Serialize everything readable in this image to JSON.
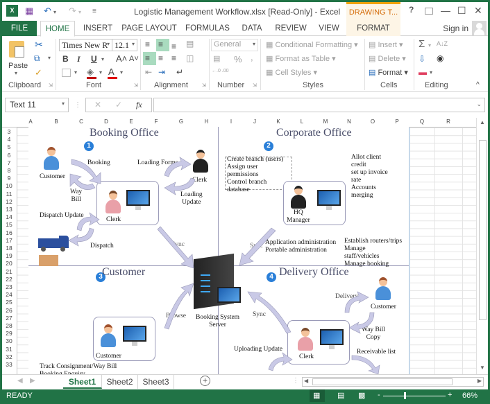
{
  "window": {
    "title": "Logistic Management Workflow.xlsx  [Read-Only] - Excel",
    "contextual_tab_group": "DRAWING T...",
    "help": "?",
    "restore_ribbon": "↑",
    "minimize": "—",
    "maximize": "☐",
    "close": "✕"
  },
  "quick_access": {
    "save": "💾",
    "undo": "↶",
    "redo": "↷",
    "customize": "≡"
  },
  "tabs": [
    "FILE",
    "HOME",
    "INSERT",
    "PAGE LAYOUT",
    "FORMULAS",
    "DATA",
    "REVIEW",
    "VIEW",
    "FORMAT"
  ],
  "sign_in": "Sign in",
  "ribbon": {
    "clipboard": {
      "label": "Clipboard",
      "paste": "Paste"
    },
    "font": {
      "label": "Font",
      "font_name": "Times New R",
      "font_size": "12.1",
      "bold": "B",
      "italic": "I",
      "underline": "U",
      "grow": "A˄",
      "shrink": "A˅",
      "font_color": "A"
    },
    "alignment": {
      "label": "Alignment"
    },
    "number": {
      "label": "Number",
      "format": "General",
      "percent": "%",
      "comma": ",",
      "inc_decimal": "←.0 .00",
      "dec_decimal": ".00 →.0"
    },
    "styles": {
      "label": "Styles",
      "conditional": "Conditional Formatting",
      "format_table": "Format as Table",
      "cell_styles": "Cell Styles"
    },
    "cells": {
      "label": "Cells",
      "insert": "Insert",
      "delete": "Delete",
      "format": "Format"
    },
    "editing": {
      "label": "Editing",
      "sum": "Σ",
      "sort": "A↓Z",
      "find": "🔍"
    },
    "collapse": "^"
  },
  "formula_bar": {
    "name_box": "Text 11",
    "cancel": "✕",
    "enter": "✓",
    "fx": "fx",
    "value": ""
  },
  "columns": [
    "A",
    "B",
    "C",
    "D",
    "E",
    "F",
    "G",
    "H",
    "I",
    "J",
    "K",
    "L",
    "M",
    "N",
    "O",
    "P",
    "Q",
    "R"
  ],
  "rows": [
    "3",
    "4",
    "5",
    "6",
    "7",
    "8",
    "9",
    "10",
    "11",
    "12",
    "13",
    "14",
    "15",
    "16",
    "17",
    "18",
    "19",
    "20",
    "21",
    "22",
    "23",
    "24",
    "25",
    "26",
    "27",
    "28",
    "29",
    "30",
    "31",
    "32",
    "33"
  ],
  "diagram": {
    "quadrants": {
      "booking": {
        "title": "Booking Office",
        "badge": "1"
      },
      "corporate": {
        "title": "Corporate Office",
        "badge": "2"
      },
      "customer": {
        "title": "Customer",
        "badge": "3"
      },
      "delivery": {
        "title": "Delivery Office",
        "badge": "4"
      }
    },
    "booking_labels": {
      "customer": "Customer",
      "booking": "Booking",
      "way_bill": "Way\nBill",
      "loading_forms": "Loading Forms",
      "clerk_dark": "Clerk",
      "loading_update": "Loading\nUpdate",
      "clerk": "Clerk",
      "dispatch_update": "Dispatch Update",
      "dispatch": "Dispatch",
      "sync": "Sync"
    },
    "corporate_labels": {
      "textbox": [
        "Create branch (users)",
        "Assign user",
        "permissions",
        "Control branch",
        "database"
      ],
      "right_text": [
        "Allot client",
        "credit",
        "set up invoice",
        "rate",
        "Accounts",
        "merging"
      ],
      "hq_manager": "HQ\nManager",
      "sync": "Sync",
      "admin_text": [
        "Application administration",
        "Portable administration"
      ],
      "establish_text": [
        "Establish routers/trips",
        "Manage",
        "staff/vehicles",
        "Manage booking"
      ]
    },
    "server_label": "Booking System\nServer",
    "customer_labels": {
      "browse": "Browse",
      "customer": "Customer",
      "track": "Track Consignment/Way Bill",
      "booking_enquiry": "Booking Enquiry"
    },
    "delivery_labels": {
      "sync": "Sync",
      "delivery": "Delivery",
      "customer": "Customer",
      "way_bill_copy": "Way Bill\nCopy",
      "receivable": "Receivable list",
      "clerk": "Clerk",
      "uploading": "Uploading Update"
    }
  },
  "sheets": [
    "Sheet1",
    "Sheet2",
    "Sheet3"
  ],
  "active_sheet": "Sheet1",
  "add_sheet": "+",
  "status": {
    "mode": "READY",
    "zoom": "66%",
    "zoom_minus": "-",
    "zoom_plus": "+"
  },
  "colors": {
    "excel_green": "#217346",
    "drawing_tools_orange": "#d46b08",
    "badge_blue": "#2a7fd8"
  }
}
